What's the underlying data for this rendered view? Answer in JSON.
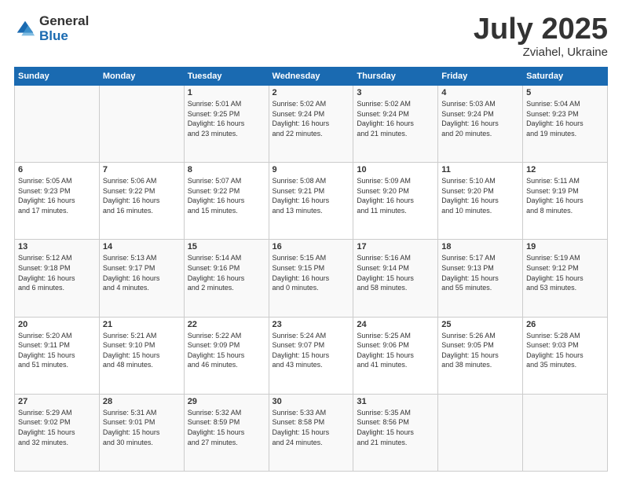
{
  "logo": {
    "general": "General",
    "blue": "Blue"
  },
  "title": {
    "month": "July 2025",
    "location": "Zviahel, Ukraine"
  },
  "days_of_week": [
    "Sunday",
    "Monday",
    "Tuesday",
    "Wednesday",
    "Thursday",
    "Friday",
    "Saturday"
  ],
  "weeks": [
    [
      {
        "day": "",
        "info": ""
      },
      {
        "day": "",
        "info": ""
      },
      {
        "day": "1",
        "info": "Sunrise: 5:01 AM\nSunset: 9:25 PM\nDaylight: 16 hours\nand 23 minutes."
      },
      {
        "day": "2",
        "info": "Sunrise: 5:02 AM\nSunset: 9:24 PM\nDaylight: 16 hours\nand 22 minutes."
      },
      {
        "day": "3",
        "info": "Sunrise: 5:02 AM\nSunset: 9:24 PM\nDaylight: 16 hours\nand 21 minutes."
      },
      {
        "day": "4",
        "info": "Sunrise: 5:03 AM\nSunset: 9:24 PM\nDaylight: 16 hours\nand 20 minutes."
      },
      {
        "day": "5",
        "info": "Sunrise: 5:04 AM\nSunset: 9:23 PM\nDaylight: 16 hours\nand 19 minutes."
      }
    ],
    [
      {
        "day": "6",
        "info": "Sunrise: 5:05 AM\nSunset: 9:23 PM\nDaylight: 16 hours\nand 17 minutes."
      },
      {
        "day": "7",
        "info": "Sunrise: 5:06 AM\nSunset: 9:22 PM\nDaylight: 16 hours\nand 16 minutes."
      },
      {
        "day": "8",
        "info": "Sunrise: 5:07 AM\nSunset: 9:22 PM\nDaylight: 16 hours\nand 15 minutes."
      },
      {
        "day": "9",
        "info": "Sunrise: 5:08 AM\nSunset: 9:21 PM\nDaylight: 16 hours\nand 13 minutes."
      },
      {
        "day": "10",
        "info": "Sunrise: 5:09 AM\nSunset: 9:20 PM\nDaylight: 16 hours\nand 11 minutes."
      },
      {
        "day": "11",
        "info": "Sunrise: 5:10 AM\nSunset: 9:20 PM\nDaylight: 16 hours\nand 10 minutes."
      },
      {
        "day": "12",
        "info": "Sunrise: 5:11 AM\nSunset: 9:19 PM\nDaylight: 16 hours\nand 8 minutes."
      }
    ],
    [
      {
        "day": "13",
        "info": "Sunrise: 5:12 AM\nSunset: 9:18 PM\nDaylight: 16 hours\nand 6 minutes."
      },
      {
        "day": "14",
        "info": "Sunrise: 5:13 AM\nSunset: 9:17 PM\nDaylight: 16 hours\nand 4 minutes."
      },
      {
        "day": "15",
        "info": "Sunrise: 5:14 AM\nSunset: 9:16 PM\nDaylight: 16 hours\nand 2 minutes."
      },
      {
        "day": "16",
        "info": "Sunrise: 5:15 AM\nSunset: 9:15 PM\nDaylight: 16 hours\nand 0 minutes."
      },
      {
        "day": "17",
        "info": "Sunrise: 5:16 AM\nSunset: 9:14 PM\nDaylight: 15 hours\nand 58 minutes."
      },
      {
        "day": "18",
        "info": "Sunrise: 5:17 AM\nSunset: 9:13 PM\nDaylight: 15 hours\nand 55 minutes."
      },
      {
        "day": "19",
        "info": "Sunrise: 5:19 AM\nSunset: 9:12 PM\nDaylight: 15 hours\nand 53 minutes."
      }
    ],
    [
      {
        "day": "20",
        "info": "Sunrise: 5:20 AM\nSunset: 9:11 PM\nDaylight: 15 hours\nand 51 minutes."
      },
      {
        "day": "21",
        "info": "Sunrise: 5:21 AM\nSunset: 9:10 PM\nDaylight: 15 hours\nand 48 minutes."
      },
      {
        "day": "22",
        "info": "Sunrise: 5:22 AM\nSunset: 9:09 PM\nDaylight: 15 hours\nand 46 minutes."
      },
      {
        "day": "23",
        "info": "Sunrise: 5:24 AM\nSunset: 9:07 PM\nDaylight: 15 hours\nand 43 minutes."
      },
      {
        "day": "24",
        "info": "Sunrise: 5:25 AM\nSunset: 9:06 PM\nDaylight: 15 hours\nand 41 minutes."
      },
      {
        "day": "25",
        "info": "Sunrise: 5:26 AM\nSunset: 9:05 PM\nDaylight: 15 hours\nand 38 minutes."
      },
      {
        "day": "26",
        "info": "Sunrise: 5:28 AM\nSunset: 9:03 PM\nDaylight: 15 hours\nand 35 minutes."
      }
    ],
    [
      {
        "day": "27",
        "info": "Sunrise: 5:29 AM\nSunset: 9:02 PM\nDaylight: 15 hours\nand 32 minutes."
      },
      {
        "day": "28",
        "info": "Sunrise: 5:31 AM\nSunset: 9:01 PM\nDaylight: 15 hours\nand 30 minutes."
      },
      {
        "day": "29",
        "info": "Sunrise: 5:32 AM\nSunset: 8:59 PM\nDaylight: 15 hours\nand 27 minutes."
      },
      {
        "day": "30",
        "info": "Sunrise: 5:33 AM\nSunset: 8:58 PM\nDaylight: 15 hours\nand 24 minutes."
      },
      {
        "day": "31",
        "info": "Sunrise: 5:35 AM\nSunset: 8:56 PM\nDaylight: 15 hours\nand 21 minutes."
      },
      {
        "day": "",
        "info": ""
      },
      {
        "day": "",
        "info": ""
      }
    ]
  ]
}
